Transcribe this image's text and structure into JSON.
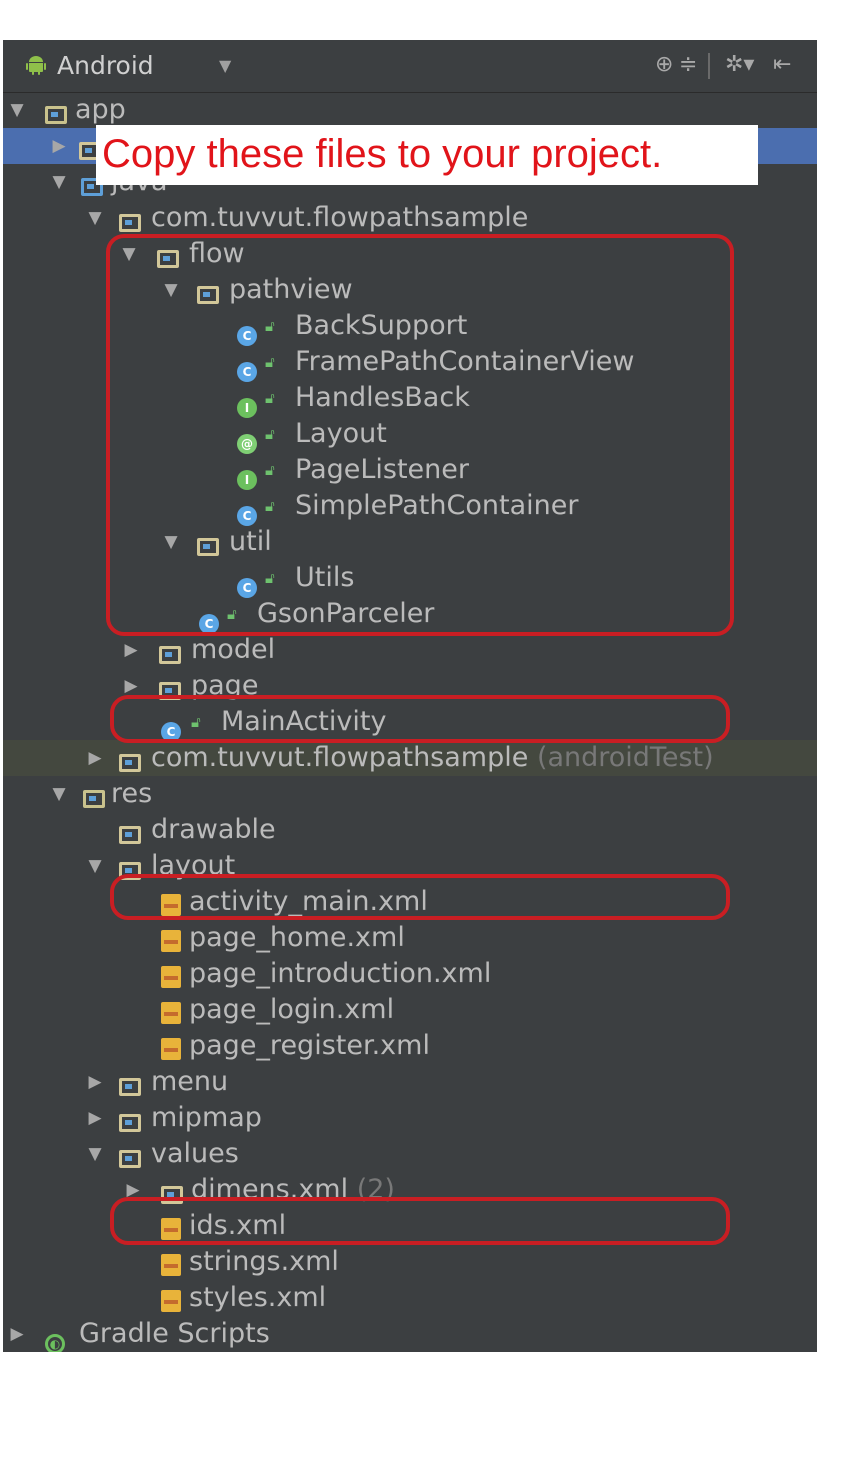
{
  "toolbar": {
    "title": "Android",
    "dropdown_icon": "chevron-down-icon",
    "buttons": [
      "crosshair-icon",
      "collapse-icon",
      "gear-icon",
      "hide-icon"
    ]
  },
  "callout": {
    "text": "Copy these files to your project."
  },
  "tree": {
    "app": "app",
    "java": "java",
    "pkg": "com.tuvvut.flowpathsample",
    "flow": "flow",
    "pathview": "pathview",
    "back_support": "BackSupport",
    "frame_path": "FramePathContainerView",
    "handles_back": "HandlesBack",
    "layout_annotation": "Layout",
    "page_listener": "PageListener",
    "simple_path": "SimplePathContainer",
    "util": "util",
    "utils": "Utils",
    "gson": "GsonParceler",
    "model": "model",
    "page": "page",
    "main_activity": "MainActivity",
    "pkg_test": "com.tuvvut.flowpathsample",
    "pkg_test_suffix": "(androidTest)",
    "res": "res",
    "drawable": "drawable",
    "layout": "layout",
    "activity_main": "activity_main.xml",
    "page_home": "page_home.xml",
    "page_intro": "page_introduction.xml",
    "page_login": "page_login.xml",
    "page_register": "page_register.xml",
    "menu": "menu",
    "mipmap": "mipmap",
    "values": "values",
    "dimens": "dimens.xml",
    "dimens_count": "(2)",
    "ids": "ids.xml",
    "strings": "strings.xml",
    "styles": "styles.xml",
    "gradle": "Gradle Scripts"
  },
  "colors": {
    "panel_bg": "#3c3f41",
    "selection": "#4b6eaf",
    "highlight_row": "#44483f",
    "annotation_red": "#c91e23",
    "text": "#bbbbbb"
  }
}
